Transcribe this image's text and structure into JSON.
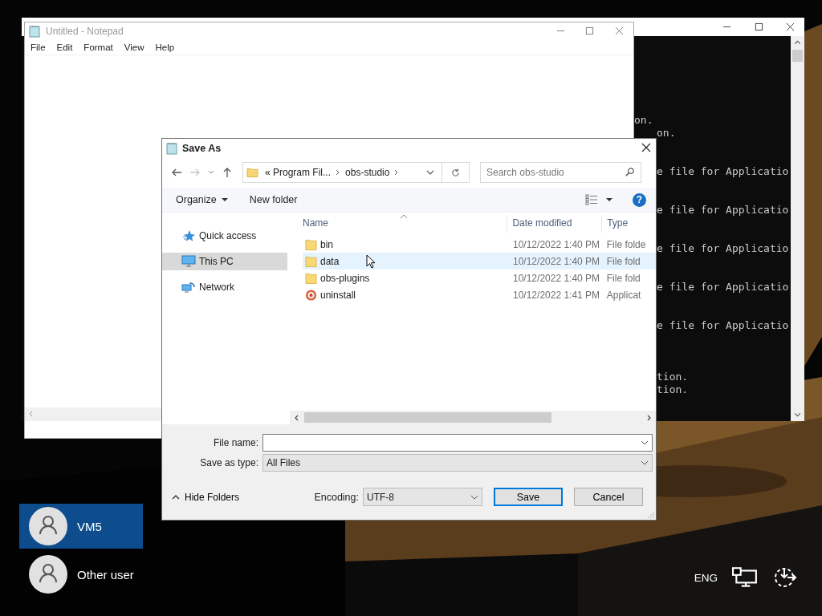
{
  "console_window": {
    "lines": [
      {
        "text": "on."
      },
      {
        "text": "on."
      },
      {
        "text": "e file for Applicatio"
      },
      {
        "text": "e file for Applicatio"
      },
      {
        "text": "e file for Applicatio"
      },
      {
        "text": "e file for Applicatio"
      },
      {
        "text": "e file for Applicatio"
      },
      {
        "text": "tion."
      },
      {
        "text": "tion."
      }
    ]
  },
  "notepad": {
    "title": "Untitled - Notepad",
    "active": false,
    "menu": [
      "File",
      "Edit",
      "Format",
      "View",
      "Help"
    ]
  },
  "save_dialog": {
    "title": "Save As",
    "breadcrumb": [
      "« Program Fil...",
      "obs-studio"
    ],
    "search": {
      "placeholder": "Search obs-studio"
    },
    "toolbar": {
      "organize": "Organize",
      "new_folder": "New folder",
      "help": "?"
    },
    "nav": [
      {
        "label": "Quick access",
        "kind": "star",
        "selected": false
      },
      {
        "label": "This PC",
        "kind": "pc",
        "selected": true
      },
      {
        "label": "Network",
        "kind": "network",
        "selected": false
      }
    ],
    "columns": [
      "Name",
      "Date modified",
      "Type"
    ],
    "rows": [
      {
        "name": "bin",
        "kind": "folder",
        "date": "10/12/2022 1:40 PM",
        "type": "File folde",
        "hovered": false
      },
      {
        "name": "data",
        "kind": "folder",
        "date": "10/12/2022 1:40 PM",
        "type": "File fold",
        "hovered": true
      },
      {
        "name": "obs-plugins",
        "kind": "folder",
        "date": "10/12/2022 1:40 PM",
        "type": "File fold",
        "hovered": false
      },
      {
        "name": "uninstall",
        "kind": "app",
        "date": "10/12/2022 1:41 PM",
        "type": "Applicat",
        "hovered": false
      }
    ],
    "file_name": {
      "label": "File name:"
    },
    "save_as_type": {
      "label": "Save as type:",
      "value": "All Files"
    },
    "hide_folders": "Hide Folders",
    "encoding": {
      "label": "Encoding:",
      "value": "UTF-8"
    },
    "buttons": [
      {
        "label": "Save",
        "default": true
      },
      {
        "label": "Cancel",
        "default": false
      }
    ]
  },
  "lock_screen": {
    "users": [
      {
        "name": "VM5",
        "selected": true
      },
      {
        "name": "Other user",
        "selected": false
      }
    ],
    "language": "ENG"
  }
}
